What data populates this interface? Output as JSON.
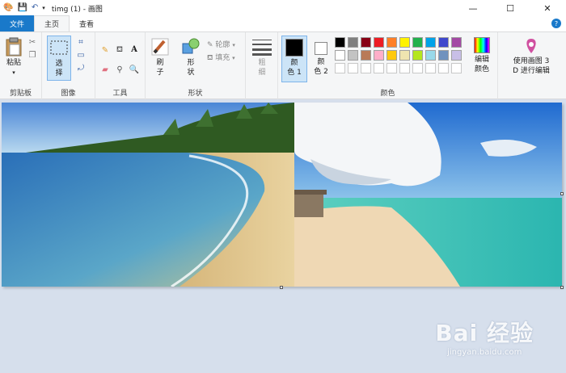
{
  "window": {
    "title": "timg (1) - 画图",
    "minimize": "—",
    "maximize": "☐",
    "close": "✕"
  },
  "tabs": [
    {
      "label": "文件"
    },
    {
      "label": "主页"
    },
    {
      "label": "查看"
    }
  ],
  "help_glyph": "?",
  "ribbon": {
    "clipboard": {
      "label": "剪贴板",
      "paste": "粘贴"
    },
    "image": {
      "label": "图像",
      "select_top": "选",
      "select_bottom": "择"
    },
    "tools": {
      "label": "工具"
    },
    "shapes": {
      "label": "形状",
      "brush_top": "刷",
      "brush_bottom": "子",
      "shape_top": "形",
      "shape_bottom": "状",
      "outline": "轮廓",
      "fill": "填充"
    },
    "size": {
      "top": "粗",
      "bottom": "细"
    },
    "color1": {
      "top": "颜",
      "bottom": "色 1"
    },
    "color2": {
      "top": "颜",
      "bottom": "色 2"
    },
    "colors": {
      "label": "颜色"
    },
    "edit_colors": {
      "top": "编辑",
      "bottom": "颜色"
    },
    "paint3d": {
      "top": "使用画图 3",
      "bottom": "D 进行编辑"
    }
  },
  "palette": {
    "row1": [
      "#000000",
      "#7f7f7f",
      "#880015",
      "#ed1c24",
      "#ff7f27",
      "#fff200",
      "#22b14c",
      "#00a2e8",
      "#3f48cc",
      "#a349a4"
    ],
    "row2": [
      "#ffffff",
      "#c3c3c3",
      "#b97a57",
      "#ffaec9",
      "#ffc90e",
      "#efe4b0",
      "#b5e61d",
      "#99d9ea",
      "#7092be",
      "#c8bfe7"
    ],
    "row3": [
      "#ffffff",
      "#ffffff",
      "#ffffff",
      "#ffffff",
      "#ffffff",
      "#ffffff",
      "#ffffff",
      "#ffffff",
      "#ffffff",
      "#ffffff"
    ]
  },
  "watermark": {
    "main": "Bai 经验",
    "sub": "jingyan.baidu.com"
  }
}
